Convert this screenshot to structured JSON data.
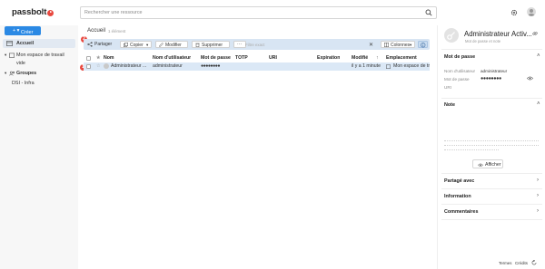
{
  "app": {
    "name": "passbolt"
  },
  "search": {
    "placeholder": "Rechercher une ressource"
  },
  "sidebar": {
    "create_label": "Créer",
    "items": [
      {
        "label": "Accueil"
      },
      {
        "label": "Mon espace de travail"
      },
      {
        "label": "vide"
      },
      {
        "label": "Groupes"
      },
      {
        "label": "DSI - Infra"
      }
    ]
  },
  "main": {
    "breadcrumb": "Accueil",
    "count": "1 élément",
    "toolbar": {
      "share": "Partager",
      "copy": "Copier",
      "edit": "Modifier",
      "delete": "Supprimer",
      "more": "···",
      "filter_placeholder": "Filtre exact",
      "columns": "Colonnes"
    },
    "markers": {
      "one": "1",
      "two": "2"
    },
    "columns": [
      "Nom",
      "Nom d'utilisateur",
      "Mot de passe",
      "TOTP",
      "URI",
      "Expiration",
      "Modifié",
      "Emplacement"
    ],
    "rows": [
      {
        "name": "Administrateur ...",
        "username": "administrateur",
        "password": "●●●●●●●●",
        "totp": "",
        "uri": "",
        "expiration": "",
        "modified": "il y a 1 minute",
        "location": "Mon espace de tr..."
      }
    ]
  },
  "panel": {
    "title": "Administrateur Activ...",
    "subtitle": "Mot de passe et note",
    "password_section": "Mot de passe",
    "fields": [
      {
        "key": "Nom d'utilisateur",
        "value": "administrateur"
      },
      {
        "key": "Mot de passe",
        "value": "●●●●●●●●"
      },
      {
        "key": "URI",
        "value": ""
      }
    ],
    "note_section": "Note",
    "show_button": "Afficher",
    "sharing_section": "Partagé avec",
    "information_section": "Information",
    "comments_section": "Commentaires"
  },
  "footer": {
    "terms": "Termes",
    "credits": "Crédits"
  },
  "colors": {
    "accent": "#2b89e4",
    "brand_red": "#e8483f",
    "selection": "#dbe8f6"
  }
}
